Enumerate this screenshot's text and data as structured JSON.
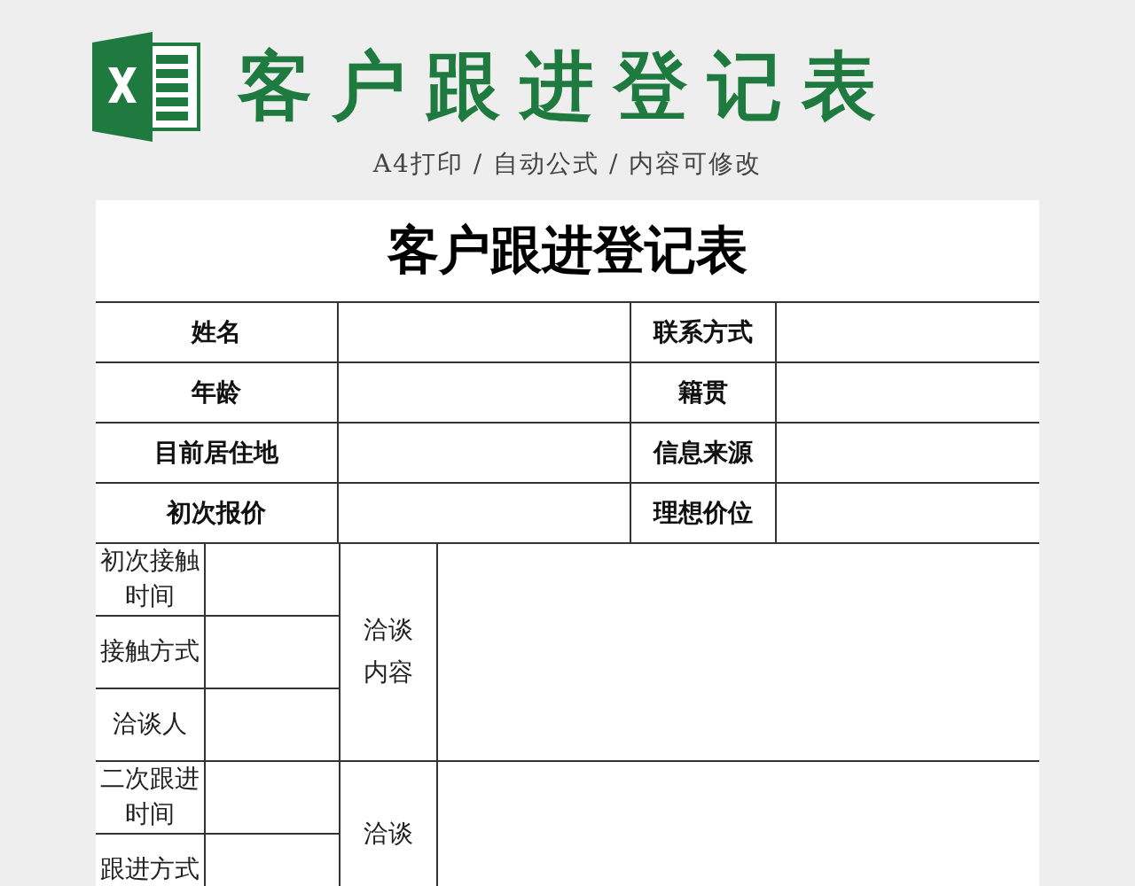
{
  "header": {
    "title": "客户跟进登记表",
    "subtitle": "A4打印 / 自动公式 / 内容可修改"
  },
  "sheet": {
    "title": "客户跟进登记表",
    "info_rows": [
      {
        "left": "姓名",
        "right": "联系方式"
      },
      {
        "left": "年龄",
        "right": "籍贯"
      },
      {
        "left": "目前居住地",
        "right": "信息来源"
      },
      {
        "left": "初次报价",
        "right": "理想价位"
      }
    ],
    "contact_groups": [
      {
        "fields": [
          "初次接触时间",
          "接触方式",
          "洽谈人"
        ],
        "notes_label": "洽谈内容"
      },
      {
        "fields": [
          "二次跟进时间",
          "跟进方式"
        ],
        "notes_label": "洽谈"
      }
    ]
  }
}
